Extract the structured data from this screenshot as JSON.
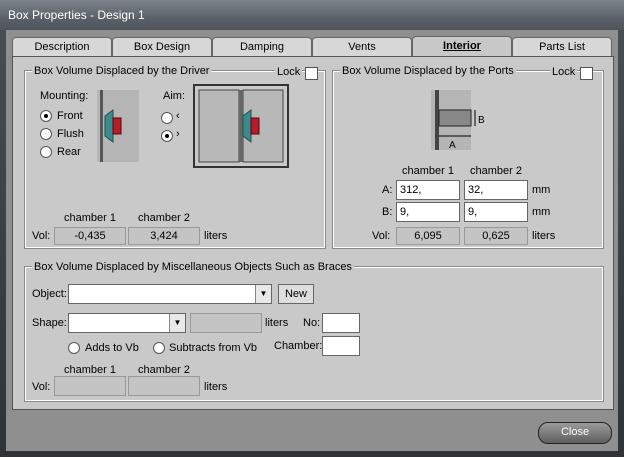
{
  "window": {
    "title": "Box Properties - Design 1"
  },
  "tabs": [
    "Description",
    "Box Design",
    "Damping",
    "Vents",
    "Interior",
    "Parts List"
  ],
  "driver_group": {
    "title": "Box Volume Displaced by the Driver",
    "lock_label": "Lock",
    "mounting_label": "Mounting:",
    "mounting_options": [
      "Front",
      "Flush",
      "Rear"
    ],
    "aim_label": "Aim:",
    "aim_options": [
      "‹",
      "›"
    ],
    "chamber1_label": "chamber 1",
    "chamber2_label": "chamber 2",
    "vol_label": "Vol:",
    "vol1": "-0,435",
    "vol2": "3,424",
    "units": "liters"
  },
  "ports_group": {
    "title": "Box Volume Displaced by the Ports",
    "lock_label": "Lock",
    "chamber1_label": "chamber 1",
    "chamber2_label": "chamber 2",
    "a_label": "A:",
    "b_label": "B:",
    "a1": "312,",
    "a2": "32,",
    "b1": "9,",
    "b2": "9,",
    "mm": "mm",
    "vol_label": "Vol:",
    "vol1": "6,095",
    "vol2": "0,625",
    "units": "liters",
    "diagram_a": "A",
    "diagram_b": "B"
  },
  "misc_group": {
    "title": "Box Volume Displaced by Miscellaneous Objects Such as Braces",
    "object_label": "Object:",
    "object_value": "",
    "new_button": "New",
    "shape_label": "Shape:",
    "shape_value": "",
    "shape_units": "liters",
    "no_label": "No:",
    "no_value": "",
    "adds_label": "Adds to Vb",
    "subtracts_label": "Subtracts from Vb",
    "chamber_label": "Chamber:",
    "chamber_value": "",
    "chamber1_label": "chamber 1",
    "chamber2_label": "chamber 2",
    "vol_label": "Vol:",
    "vol1": "",
    "vol2": "",
    "units": "liters"
  },
  "close_button": "Close"
}
